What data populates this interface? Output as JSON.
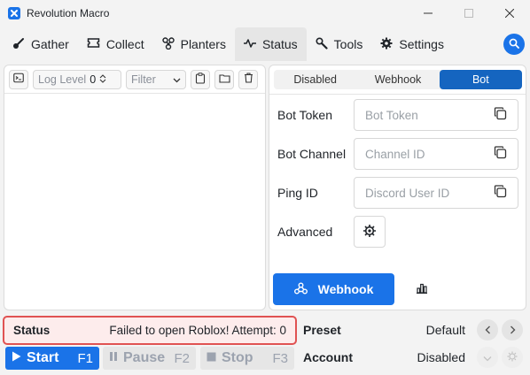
{
  "window": {
    "title": "Revolution Macro"
  },
  "nav": {
    "tabs": [
      {
        "label": "Gather",
        "icon": "gather-icon"
      },
      {
        "label": "Collect",
        "icon": "ticket-icon"
      },
      {
        "label": "Planters",
        "icon": "planter-icon"
      },
      {
        "label": "Status",
        "icon": "pulse-icon",
        "active": true
      },
      {
        "label": "Tools",
        "icon": "wrench-icon"
      },
      {
        "label": "Settings",
        "icon": "gear-icon"
      }
    ]
  },
  "log": {
    "level_label": "Log Level",
    "level_value": "0",
    "filter_placeholder": "Filter"
  },
  "discord": {
    "modes": [
      "Disabled",
      "Webhook",
      "Bot"
    ],
    "active_mode": "Bot",
    "fields": [
      {
        "label": "Bot Token",
        "placeholder": "Bot Token"
      },
      {
        "label": "Bot Channel",
        "placeholder": "Channel ID"
      },
      {
        "label": "Ping ID",
        "placeholder": "Discord User ID"
      }
    ],
    "advanced_label": "Advanced",
    "webhook_button": "Webhook"
  },
  "status": {
    "title": "Status",
    "message": "Failed to open Roblox! Attempt: 0",
    "error_color": "#e05252"
  },
  "controls": {
    "start": {
      "label": "Start",
      "key": "F1"
    },
    "pause": {
      "label": "Pause",
      "key": "F2"
    },
    "stop": {
      "label": "Stop",
      "key": "F3"
    }
  },
  "preset": {
    "label": "Preset",
    "value": "Default"
  },
  "account": {
    "label": "Account",
    "value": "Disabled"
  },
  "colors": {
    "accent": "#1a73e8",
    "active_segment": "#1565c0"
  }
}
